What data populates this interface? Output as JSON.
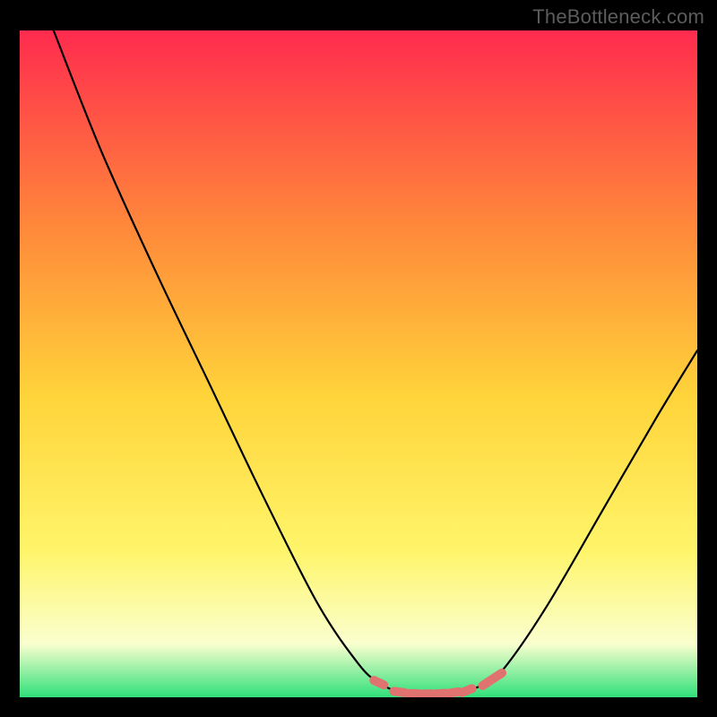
{
  "watermark": "TheBottleneck.com",
  "colors": {
    "frame": "#000000",
    "gradient_top": "#ff2b4e",
    "gradient_mid_upper": "#ff8a3a",
    "gradient_mid": "#ffd43a",
    "gradient_lower": "#fff56a",
    "gradient_pale": "#faffcf",
    "gradient_bottom": "#2fe07a",
    "curve": "#000000",
    "marker": "#e0736f"
  },
  "chart_data": {
    "type": "line",
    "title": "",
    "xlabel": "",
    "ylabel": "",
    "xlim": [
      0,
      100
    ],
    "ylim": [
      0,
      100
    ],
    "series": [
      {
        "name": "curve",
        "points": [
          {
            "x": 5,
            "y": 100
          },
          {
            "x": 12,
            "y": 82
          },
          {
            "x": 20,
            "y": 64
          },
          {
            "x": 28,
            "y": 47
          },
          {
            "x": 36,
            "y": 30
          },
          {
            "x": 44,
            "y": 14
          },
          {
            "x": 50,
            "y": 5
          },
          {
            "x": 53,
            "y": 2.2
          },
          {
            "x": 56,
            "y": 0.8
          },
          {
            "x": 60,
            "y": 0.5
          },
          {
            "x": 65,
            "y": 0.8
          },
          {
            "x": 69,
            "y": 2.2
          },
          {
            "x": 72,
            "y": 5
          },
          {
            "x": 78,
            "y": 14
          },
          {
            "x": 86,
            "y": 28
          },
          {
            "x": 94,
            "y": 42
          },
          {
            "x": 100,
            "y": 52
          }
        ]
      }
    ],
    "markers": [
      {
        "x": 53,
        "y": 2.2
      },
      {
        "x": 56,
        "y": 0.8
      },
      {
        "x": 58,
        "y": 0.55
      },
      {
        "x": 60,
        "y": 0.5
      },
      {
        "x": 62,
        "y": 0.55
      },
      {
        "x": 64,
        "y": 0.7
      },
      {
        "x": 66,
        "y": 1.0
      },
      {
        "x": 69,
        "y": 2.2
      },
      {
        "x": 70.5,
        "y": 3.2
      }
    ]
  }
}
